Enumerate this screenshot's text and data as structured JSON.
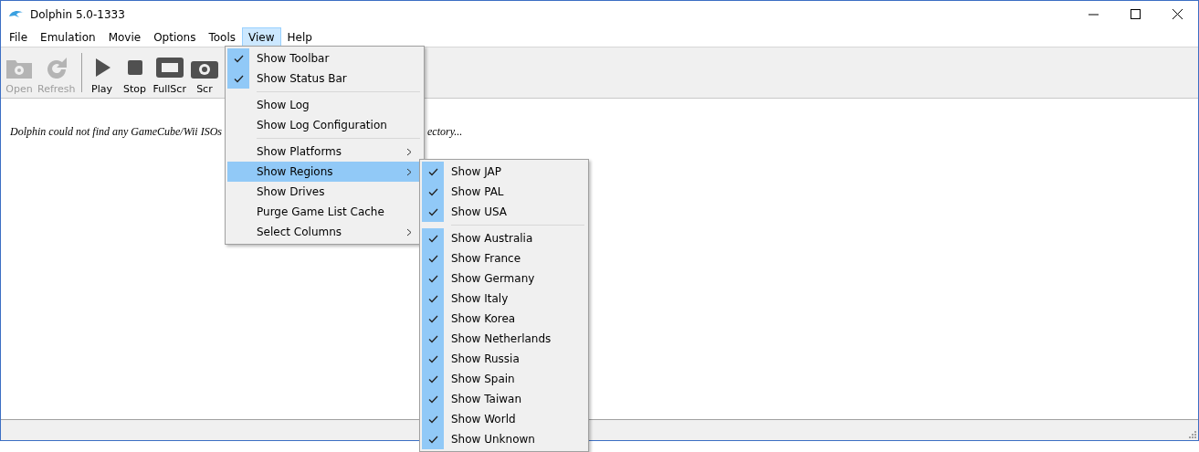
{
  "window": {
    "title": "Dolphin 5.0-1333"
  },
  "menu_bar": [
    {
      "label": "File",
      "selected": false
    },
    {
      "label": "Emulation",
      "selected": false
    },
    {
      "label": "Movie",
      "selected": false
    },
    {
      "label": "Options",
      "selected": false
    },
    {
      "label": "Tools",
      "selected": false
    },
    {
      "label": "View",
      "selected": true
    },
    {
      "label": "Help",
      "selected": false
    }
  ],
  "toolbar": [
    {
      "label": "Open",
      "disabled": true
    },
    {
      "label": "Refresh",
      "disabled": true
    },
    {
      "kind": "separator"
    },
    {
      "label": "Play",
      "disabled": false
    },
    {
      "label": "Stop",
      "disabled": false
    },
    {
      "label": "FullScr",
      "disabled": false
    },
    {
      "label": "Scr",
      "disabled": false
    }
  ],
  "game_list": {
    "message_start": "Dolphin could not find any GameCube/Wii ISOs",
    "message_end": "ectory..."
  },
  "view_menu": {
    "items": [
      {
        "kind": "item",
        "label": "Show Toolbar",
        "checked": true,
        "has_submenu": false,
        "selected": false
      },
      {
        "kind": "item",
        "label": "Show Status Bar",
        "checked": true,
        "has_submenu": false,
        "selected": false
      },
      {
        "kind": "separator"
      },
      {
        "kind": "item",
        "label": "Show Log",
        "checked": false,
        "has_submenu": false,
        "selected": false
      },
      {
        "kind": "item",
        "label": "Show Log Configuration",
        "checked": false,
        "has_submenu": false,
        "selected": false
      },
      {
        "kind": "separator"
      },
      {
        "kind": "item",
        "label": "Show Platforms",
        "checked": false,
        "has_submenu": true,
        "selected": false
      },
      {
        "kind": "item",
        "label": "Show Regions",
        "checked": false,
        "has_submenu": true,
        "selected": true
      },
      {
        "kind": "item",
        "label": "Show Drives",
        "checked": false,
        "has_submenu": false,
        "selected": false
      },
      {
        "kind": "item",
        "label": "Purge Game List Cache",
        "checked": false,
        "has_submenu": false,
        "selected": false
      },
      {
        "kind": "item",
        "label": "Select Columns",
        "checked": false,
        "has_submenu": true,
        "selected": false
      }
    ]
  },
  "regions_menu": {
    "items": [
      {
        "kind": "item",
        "label": "Show JAP",
        "checked": true
      },
      {
        "kind": "item",
        "label": "Show PAL",
        "checked": true
      },
      {
        "kind": "item",
        "label": "Show USA",
        "checked": true
      },
      {
        "kind": "separator"
      },
      {
        "kind": "item",
        "label": "Show Australia",
        "checked": true
      },
      {
        "kind": "item",
        "label": "Show France",
        "checked": true
      },
      {
        "kind": "item",
        "label": "Show Germany",
        "checked": true
      },
      {
        "kind": "item",
        "label": "Show Italy",
        "checked": true
      },
      {
        "kind": "item",
        "label": "Show Korea",
        "checked": true
      },
      {
        "kind": "item",
        "label": "Show Netherlands",
        "checked": true
      },
      {
        "kind": "item",
        "label": "Show Russia",
        "checked": true
      },
      {
        "kind": "item",
        "label": "Show Spain",
        "checked": true
      },
      {
        "kind": "item",
        "label": "Show Taiwan",
        "checked": true
      },
      {
        "kind": "item",
        "label": "Show World",
        "checked": true
      },
      {
        "kind": "item",
        "label": "Show Unknown",
        "checked": true
      }
    ]
  }
}
